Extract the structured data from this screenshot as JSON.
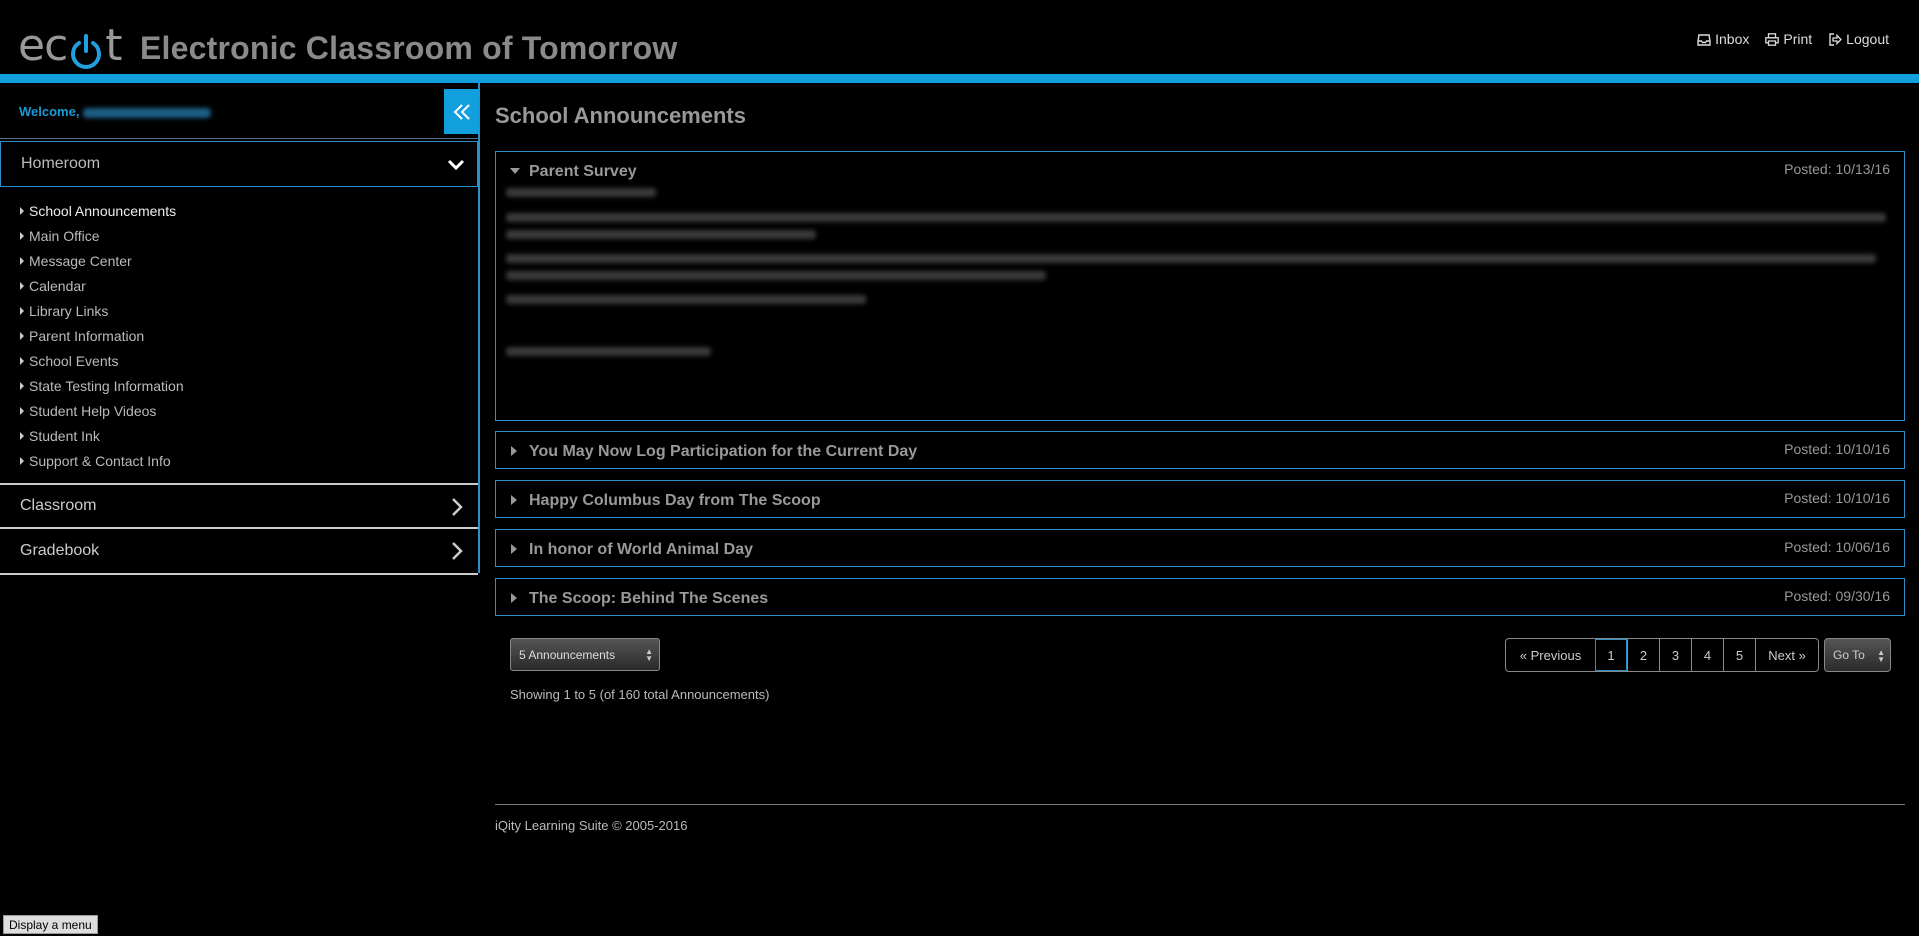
{
  "header": {
    "logo_prefix": "ec",
    "logo_suffix": "t",
    "app_title": "Electronic Classroom of Tomorrow",
    "links": [
      {
        "label": "Inbox",
        "icon": "inbox-icon"
      },
      {
        "label": "Print",
        "icon": "print-icon"
      },
      {
        "label": "Logout",
        "icon": "logout-icon"
      }
    ]
  },
  "colors": {
    "accent": "#129fdd",
    "border_blue": "#2e8fc7",
    "background": "#000000"
  },
  "sidebar": {
    "welcome_label": "Welcome,",
    "homeroom_label": "Homeroom",
    "homeroom_items": [
      {
        "label": "School Announcements",
        "active": true
      },
      {
        "label": "Main Office"
      },
      {
        "label": "Message Center"
      },
      {
        "label": "Calendar"
      },
      {
        "label": "Library Links"
      },
      {
        "label": "Parent Information"
      },
      {
        "label": "School Events"
      },
      {
        "label": "State Testing Information"
      },
      {
        "label": "Student Help Videos"
      },
      {
        "label": "Student Ink"
      },
      {
        "label": "Support & Contact Info"
      }
    ],
    "classroom_label": "Classroom",
    "gradebook_label": "Gradebook"
  },
  "main": {
    "page_title": "School Announcements",
    "announcements": [
      {
        "title": "Parent Survey",
        "posted": "Posted: 10/13/16",
        "expanded": true
      },
      {
        "title": "You May Now Log Participation for the Current Day",
        "posted": "Posted: 10/10/16"
      },
      {
        "title": "Happy Columbus Day from The Scoop",
        "posted": "Posted: 10/10/16"
      },
      {
        "title": "In honor of World Animal Day",
        "posted": "Posted: 10/06/16"
      },
      {
        "title": "The Scoop: Behind The Scenes",
        "posted": "Posted: 09/30/16"
      }
    ],
    "per_page": "5 Announcements",
    "showing": "Showing 1 to 5 (of 160 total Announcements)",
    "pager": {
      "previous": "Previous",
      "pages": [
        "1",
        "2",
        "3",
        "4",
        "5"
      ],
      "current": "1",
      "next": "Next",
      "goto": "Go To"
    }
  },
  "footer": {
    "text": "iQity Learning Suite © 2005-2016"
  },
  "display_menu_label": "Display a menu"
}
